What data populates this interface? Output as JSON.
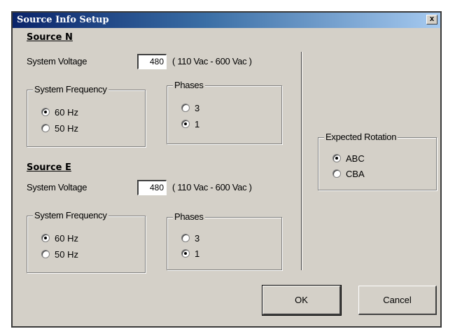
{
  "window": {
    "title": "Source Info Setup",
    "close_label": "x"
  },
  "source_n": {
    "heading": "Source N",
    "voltage_label": "System Voltage",
    "voltage_value": "480",
    "voltage_range": "( 110 Vac - 600 Vac )",
    "frequency": {
      "title": "System Frequency",
      "options": [
        "60 Hz",
        "50 Hz"
      ],
      "selected": "60 Hz"
    },
    "phases": {
      "title": "Phases",
      "options": [
        "3",
        "1"
      ],
      "selected": "1"
    }
  },
  "source_e": {
    "heading": "Source E",
    "voltage_label": "System Voltage",
    "voltage_value": "480",
    "voltage_range": "( 110 Vac - 600 Vac )",
    "frequency": {
      "title": "System Frequency",
      "options": [
        "60 Hz",
        "50 Hz"
      ],
      "selected": "60 Hz"
    },
    "phases": {
      "title": "Phases",
      "options": [
        "3",
        "1"
      ],
      "selected": "1"
    }
  },
  "rotation": {
    "title": "Expected Rotation",
    "options": [
      "ABC",
      "CBA"
    ],
    "selected": "ABC"
  },
  "buttons": {
    "ok": "OK",
    "cancel": "Cancel"
  }
}
